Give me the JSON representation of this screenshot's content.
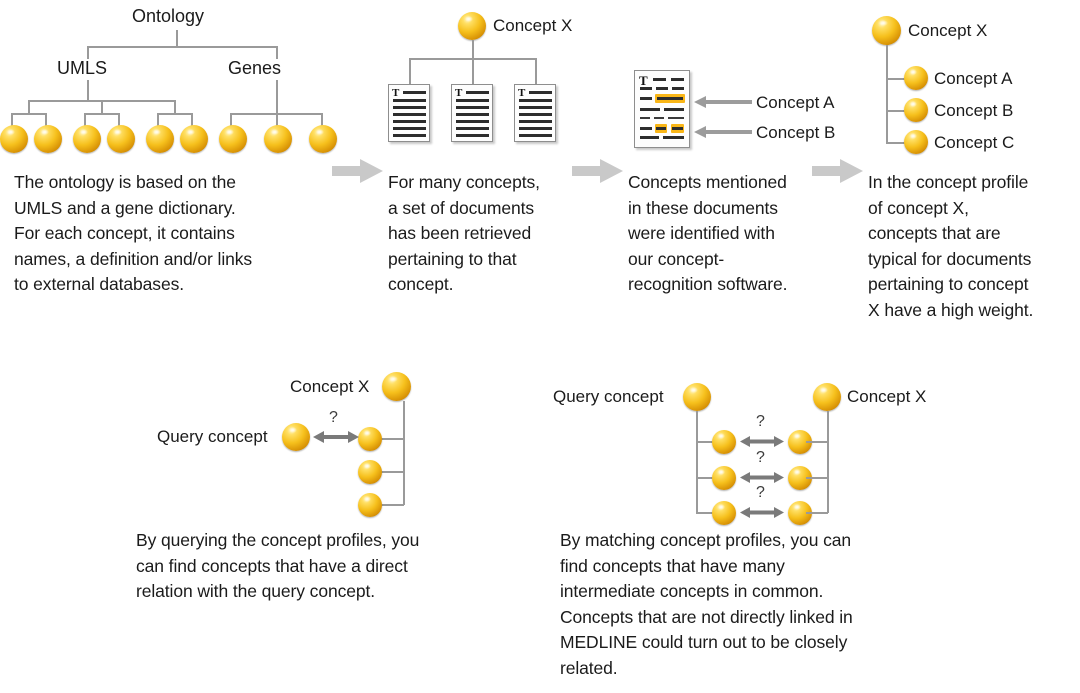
{
  "diagram": {
    "title": "Concept profile construction and matching workflow",
    "colors": {
      "sphere_highlight": "#fff7cf",
      "sphere_mid": "#f6c01c",
      "sphere_dark": "#a66a03",
      "connector_line": "#9a9a9a",
      "step_arrow": "#c9c9c9",
      "callout_arrow": "#9c9c9c",
      "highlight_marker": "#f9b617",
      "text": "#1b1b1b",
      "document_border": "#8e8e8e",
      "background": "#ffffff"
    }
  },
  "top_row": {
    "step1": {
      "tree": {
        "root_label": "Ontology",
        "branch_labels": [
          "UMLS",
          "Genes"
        ],
        "leaf_count": 9,
        "umls_leaf_groups": [
          2,
          2,
          2
        ],
        "genes_leaf_group": 3
      },
      "caption": "The ontology is based on the\nUMLS and a gene dictionary.\nFor each concept, it contains\nnames, a definition and/or links\nto external databases."
    },
    "step2": {
      "concept_label": "Concept X",
      "document_count": 3,
      "caption": "For many concepts,\na set of documents\nhas been retrieved\npertaining to that\nconcept."
    },
    "step3": {
      "callouts": [
        "Concept A",
        "Concept B"
      ],
      "caption": "Concepts mentioned\nin these documents\nwere identified with\nour concept-\nrecognition software."
    },
    "step4": {
      "root_label": "Concept X",
      "children": [
        "Concept A",
        "Concept B",
        "Concept C"
      ],
      "caption": "In the concept profile\nof concept X,\nconcepts that are\ntypical for documents\npertaining to concept\nX have a high weight."
    }
  },
  "bottom_row": {
    "left": {
      "concept_x_label": "Concept X",
      "query_label": "Query concept",
      "question_mark": "?",
      "profile_node_count": 3,
      "caption": "By querying the concept profiles, you\ncan find concepts that have a direct\nrelation with the query concept."
    },
    "right": {
      "query_label": "Query concept",
      "concept_x_label": "Concept X",
      "question_marks": [
        "?",
        "?",
        "?"
      ],
      "intermediate_pairs": 3,
      "caption": "By matching concept profiles, you can\nfind concepts that have many\nintermediate concepts in common.\nConcepts that are not directly linked in\nMEDLINE could turn out to be closely\nrelated."
    }
  },
  "icons": {
    "sphere": "concept-sphere-icon",
    "document": "document-icon",
    "step_arrow": "right-block-arrow-icon",
    "callout_arrow": "left-pointer-arrow-icon",
    "double_arrow": "bidirectional-arrow-icon",
    "doc_title_glyph": "T"
  }
}
